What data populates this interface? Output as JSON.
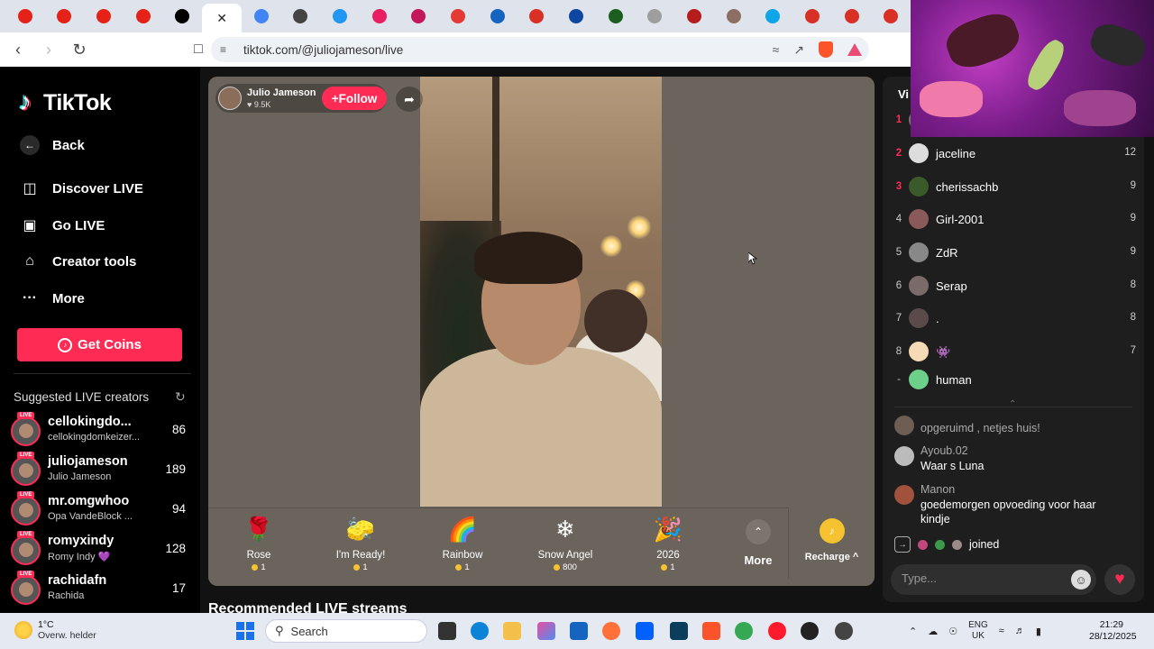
{
  "browser": {
    "url": "tiktok.com/@juliojameson/live",
    "tabs": [
      {
        "icon": "youtube-icon",
        "color": "#e62117"
      },
      {
        "icon": "youtube-icon",
        "color": "#e62117"
      },
      {
        "icon": "youtube-icon",
        "color": "#e62117"
      },
      {
        "icon": "youtube-icon",
        "color": "#e62117"
      },
      {
        "icon": "tiktok-icon",
        "color": "#000000"
      },
      {
        "icon": "close-icon",
        "active": true
      },
      {
        "icon": "google-icon",
        "color": "#4285f4"
      },
      {
        "icon": "profile-icon",
        "color": "#444444"
      },
      {
        "icon": "app-icon",
        "color": "#2196f3"
      },
      {
        "icon": "app-icon",
        "color": "#e91e63"
      },
      {
        "icon": "app-icon",
        "color": "#c2185b"
      },
      {
        "icon": "app-icon",
        "color": "#e53935"
      },
      {
        "icon": "app-icon",
        "color": "#1565c0"
      },
      {
        "icon": "gmail-icon",
        "color": "#d93025"
      },
      {
        "icon": "app-icon",
        "color": "#0d47a1"
      },
      {
        "icon": "app-icon",
        "color": "#1b5e20"
      },
      {
        "icon": "app-icon",
        "color": "#9e9e9e"
      },
      {
        "icon": "app-icon",
        "color": "#b71c1c"
      },
      {
        "icon": "app-icon",
        "color": "#8d6e63"
      },
      {
        "icon": "edge-icon",
        "color": "#0ea5e9"
      },
      {
        "icon": "gmail-icon",
        "color": "#d93025"
      },
      {
        "icon": "gmail-icon",
        "color": "#d93025"
      },
      {
        "icon": "gmail-icon",
        "color": "#d93025"
      }
    ]
  },
  "sidebar": {
    "logo": "TikTok",
    "back": "Back",
    "nav": [
      {
        "label": "Discover LIVE"
      },
      {
        "label": "Go LIVE"
      },
      {
        "label": "Creator tools"
      },
      {
        "label": "More"
      }
    ],
    "get_coins": "Get Coins",
    "suggested_heading": "Suggested LIVE creators",
    "creators": [
      {
        "name": "cellokingdo...",
        "sub": "cellokingdomkeizer...",
        "count": "86"
      },
      {
        "name": "juliojameson",
        "sub": "Julio Jameson",
        "count": "189"
      },
      {
        "name": "mr.omgwhoo",
        "sub": "Opa VandeBlock ...",
        "count": "94"
      },
      {
        "name": "romyxindy",
        "sub": "Romy Indy 💜",
        "count": "128"
      },
      {
        "name": "rachidafn",
        "sub": "Rachida",
        "count": "17"
      }
    ],
    "live_tag": "LIVE"
  },
  "stream": {
    "host_name": "Julio Jameson",
    "host_likes": "♥ 9.5K",
    "follow": "+Follow",
    "gifts": [
      {
        "name": "Rose",
        "price": "1",
        "icon": "🌹"
      },
      {
        "name": "I'm Ready!",
        "price": "1",
        "icon": "🧽"
      },
      {
        "name": "Rainbow",
        "price": "1",
        "icon": "🌈"
      },
      {
        "name": "Snow Angel",
        "price": "800",
        "icon": "❄"
      },
      {
        "name": "2026",
        "price": "1",
        "icon": "🎉"
      }
    ],
    "more": "More",
    "recharge": "Recharge ^"
  },
  "recommended_heading": "Recommended LIVE streams",
  "right_panel": {
    "heading": "Vi",
    "viewers": [
      {
        "rank": "1",
        "name": "",
        "count": ""
      },
      {
        "rank": "2",
        "name": "jaceline",
        "count": "12"
      },
      {
        "rank": "3",
        "name": "cherissachb",
        "count": "9"
      },
      {
        "rank": "4",
        "name": "Girl-2001",
        "count": "9"
      },
      {
        "rank": "5",
        "name": "ZdR",
        "count": "9"
      },
      {
        "rank": "6",
        "name": "Serap",
        "count": "8"
      },
      {
        "rank": "7",
        "name": ".",
        "count": "8"
      },
      {
        "rank": "8",
        "name": "👾",
        "count": "7"
      },
      {
        "rank": "-",
        "name": "human",
        "count": ""
      }
    ],
    "chevron": "⌃",
    "messages": [
      {
        "user": "",
        "text": "opgeruimd , netjes huis!"
      },
      {
        "user": "Ayoub.02",
        "text": "Waar s Luna"
      },
      {
        "user": "Manon",
        "text": "goedemorgen opvoeding voor haar kindje"
      }
    ],
    "joined": "joined",
    "chat_placeholder": "Type..."
  },
  "taskbar": {
    "temp": "1°C",
    "weather": "Overw. helder",
    "search": "Search",
    "lang1": "ENG",
    "lang2": "UK",
    "time": "21:29",
    "date": "28/12/2025"
  }
}
